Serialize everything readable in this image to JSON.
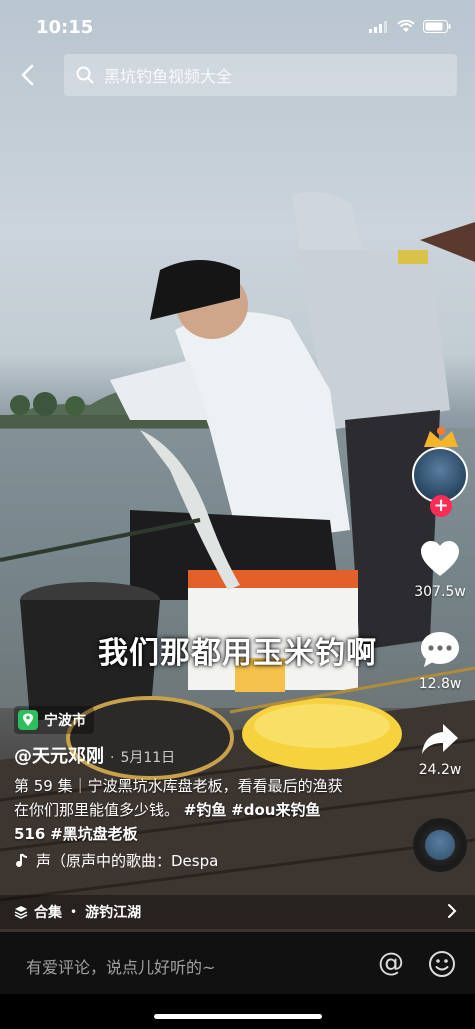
{
  "status_bar": {
    "time": "10:15"
  },
  "search": {
    "query": "黑坑钓鱼视频大全"
  },
  "video": {
    "subtitle": "我们那都用玉米钓啊"
  },
  "actions": {
    "likes": "307.5w",
    "comments": "12.8w",
    "shares": "24.2w"
  },
  "location": {
    "name": "宁波市"
  },
  "author": {
    "handle": "@天元邓刚",
    "separator": "·",
    "date": "5月11日"
  },
  "description": {
    "text": "第 59 集｜宁波黑坑水库盘老板，看看最后的渔获在你们那里能值多少钱。",
    "hashtags": [
      "#钓鱼",
      "#dou来钓鱼 516",
      "#黑坑盘老板"
    ]
  },
  "music": {
    "text": "声（原声中的歌曲：Despa"
  },
  "collection": {
    "label": "合集",
    "dot": "•",
    "name": "游钓江湖"
  },
  "comment_bar": {
    "placeholder": "有爱评论，说点儿好听的~",
    "at": "@"
  },
  "icons": [
    "back-arrow-icon",
    "search-icon",
    "heart-icon",
    "comment-icon",
    "share-icon",
    "music-note-icon",
    "location-pin-icon",
    "collection-stack-icon",
    "chevron-right-icon",
    "emoji-icon"
  ],
  "colors": {
    "accent": "#fe2c55",
    "location_pin": "#2dbe60"
  }
}
